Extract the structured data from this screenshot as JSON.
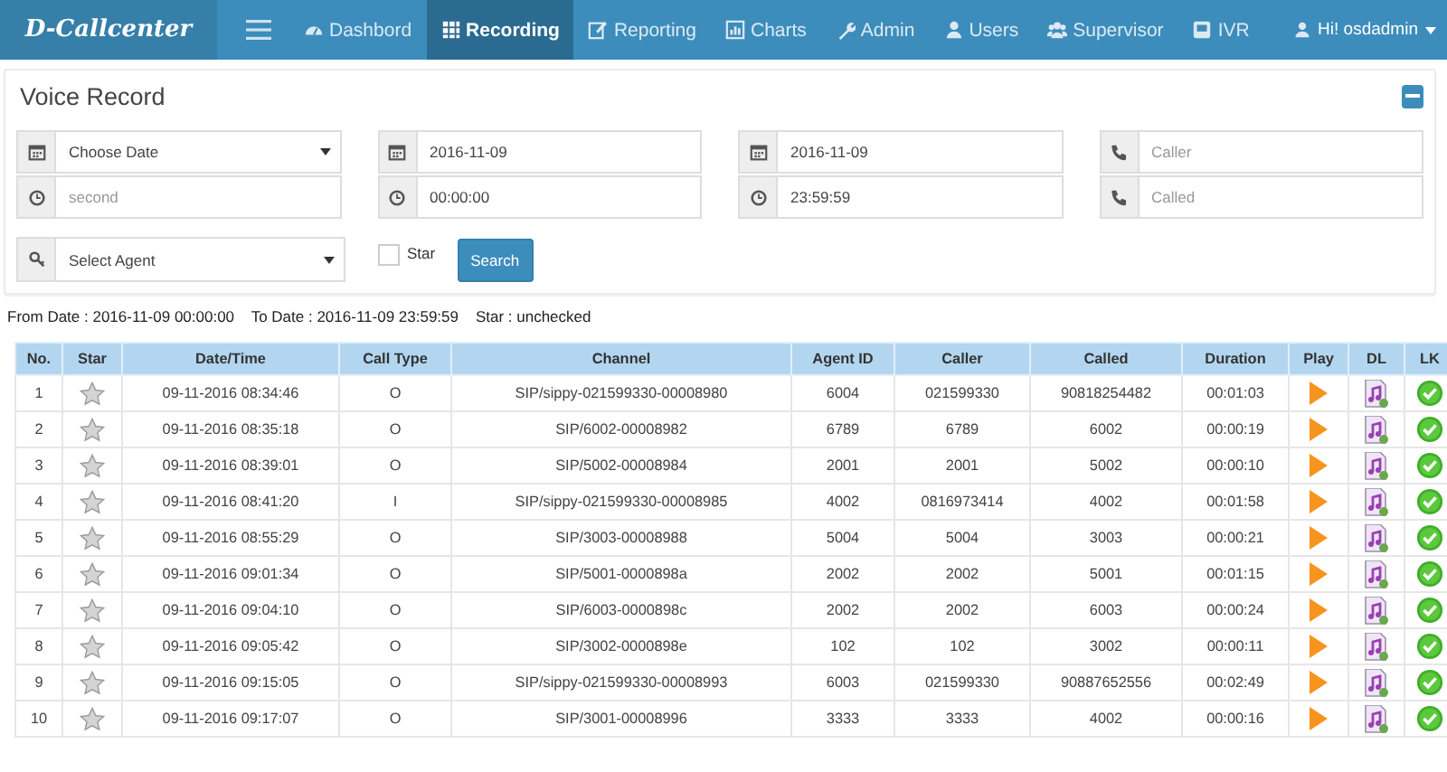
{
  "navbar": {
    "brand": "D-Callcenter",
    "items": [
      {
        "label": "Dashbord",
        "selected": false
      },
      {
        "label": "Recording",
        "selected": true
      },
      {
        "label": "Reporting",
        "selected": false
      },
      {
        "label": "Charts",
        "selected": false
      },
      {
        "label": "Admin",
        "selected": false
      },
      {
        "label": "Users",
        "selected": false
      },
      {
        "label": "Supervisor",
        "selected": false
      },
      {
        "label": "IVR",
        "selected": false
      }
    ],
    "user": "Hi! osdadmin"
  },
  "panel": {
    "title": "Voice Record",
    "field_groups": [
      [
        {
          "kind": "select",
          "value": "Choose Date"
        },
        {
          "kind": "input",
          "placeholder": "second"
        }
      ],
      [
        {
          "kind": "input",
          "value": "2016-11-09"
        },
        {
          "kind": "input",
          "value": "00:00:00"
        }
      ],
      [
        {
          "kind": "input",
          "value": "2016-11-09"
        },
        {
          "kind": "input",
          "value": "23:59:59"
        }
      ],
      [
        {
          "kind": "input",
          "placeholder": "Caller"
        },
        {
          "kind": "input",
          "placeholder": "Called"
        }
      ]
    ],
    "agent": {
      "kind": "select",
      "value": "Select Agent"
    },
    "star": {
      "label": "Star",
      "checked": false
    },
    "search_button": "Search"
  },
  "summary": "From Date : 2016-11-09 00:00:00    To Date : 2016-11-09 23:59:59    Star : unchecked",
  "table": {
    "columns": [
      "No.",
      "Star",
      "Date/Time",
      "Call Type",
      "Channel",
      "Agent ID",
      "Caller",
      "Called",
      "Duration",
      "Play",
      "DL",
      "LK"
    ],
    "rows": [
      {
        "no": "1",
        "starred": false,
        "datetime": "09-11-2016 08:34:46",
        "call_type": "O",
        "channel": "SIP/sippy-021599330-00008980",
        "agent_id": "6004",
        "caller": "021599330",
        "called": "90818254482",
        "duration": "00:01:03"
      },
      {
        "no": "2",
        "starred": false,
        "datetime": "09-11-2016 08:35:18",
        "call_type": "O",
        "channel": "SIP/6002-00008982",
        "agent_id": "6789",
        "caller": "6789",
        "called": "6002",
        "duration": "00:00:19"
      },
      {
        "no": "3",
        "starred": false,
        "datetime": "09-11-2016 08:39:01",
        "call_type": "O",
        "channel": "SIP/5002-00008984",
        "agent_id": "2001",
        "caller": "2001",
        "called": "5002",
        "duration": "00:00:10"
      },
      {
        "no": "4",
        "starred": false,
        "datetime": "09-11-2016 08:41:20",
        "call_type": "I",
        "channel": "SIP/sippy-021599330-00008985",
        "agent_id": "4002",
        "caller": "0816973414",
        "called": "4002",
        "duration": "00:01:58"
      },
      {
        "no": "5",
        "starred": false,
        "datetime": "09-11-2016 08:55:29",
        "call_type": "O",
        "channel": "SIP/3003-00008988",
        "agent_id": "5004",
        "caller": "5004",
        "called": "3003",
        "duration": "00:00:21"
      },
      {
        "no": "6",
        "starred": false,
        "datetime": "09-11-2016 09:01:34",
        "call_type": "O",
        "channel": "SIP/5001-0000898a",
        "agent_id": "2002",
        "caller": "2002",
        "called": "5001",
        "duration": "00:01:15"
      },
      {
        "no": "7",
        "starred": false,
        "datetime": "09-11-2016 09:04:10",
        "call_type": "O",
        "channel": "SIP/6003-0000898c",
        "agent_id": "2002",
        "caller": "2002",
        "called": "6003",
        "duration": "00:00:24"
      },
      {
        "no": "8",
        "starred": false,
        "datetime": "09-11-2016 09:05:42",
        "call_type": "O",
        "channel": "SIP/3002-0000898e",
        "agent_id": "102",
        "caller": "102",
        "called": "3002",
        "duration": "00:00:11"
      },
      {
        "no": "9",
        "starred": false,
        "datetime": "09-11-2016 09:15:05",
        "call_type": "O",
        "channel": "SIP/sippy-021599330-00008993",
        "agent_id": "6003",
        "caller": "021599330",
        "called": "90887652556",
        "duration": "00:02:49"
      },
      {
        "no": "10",
        "starred": false,
        "datetime": "09-11-2016 09:17:07",
        "call_type": "O",
        "channel": "SIP/3001-00008996",
        "agent_id": "3333",
        "caller": "3333",
        "called": "4002",
        "duration": "00:00:16"
      }
    ]
  }
}
